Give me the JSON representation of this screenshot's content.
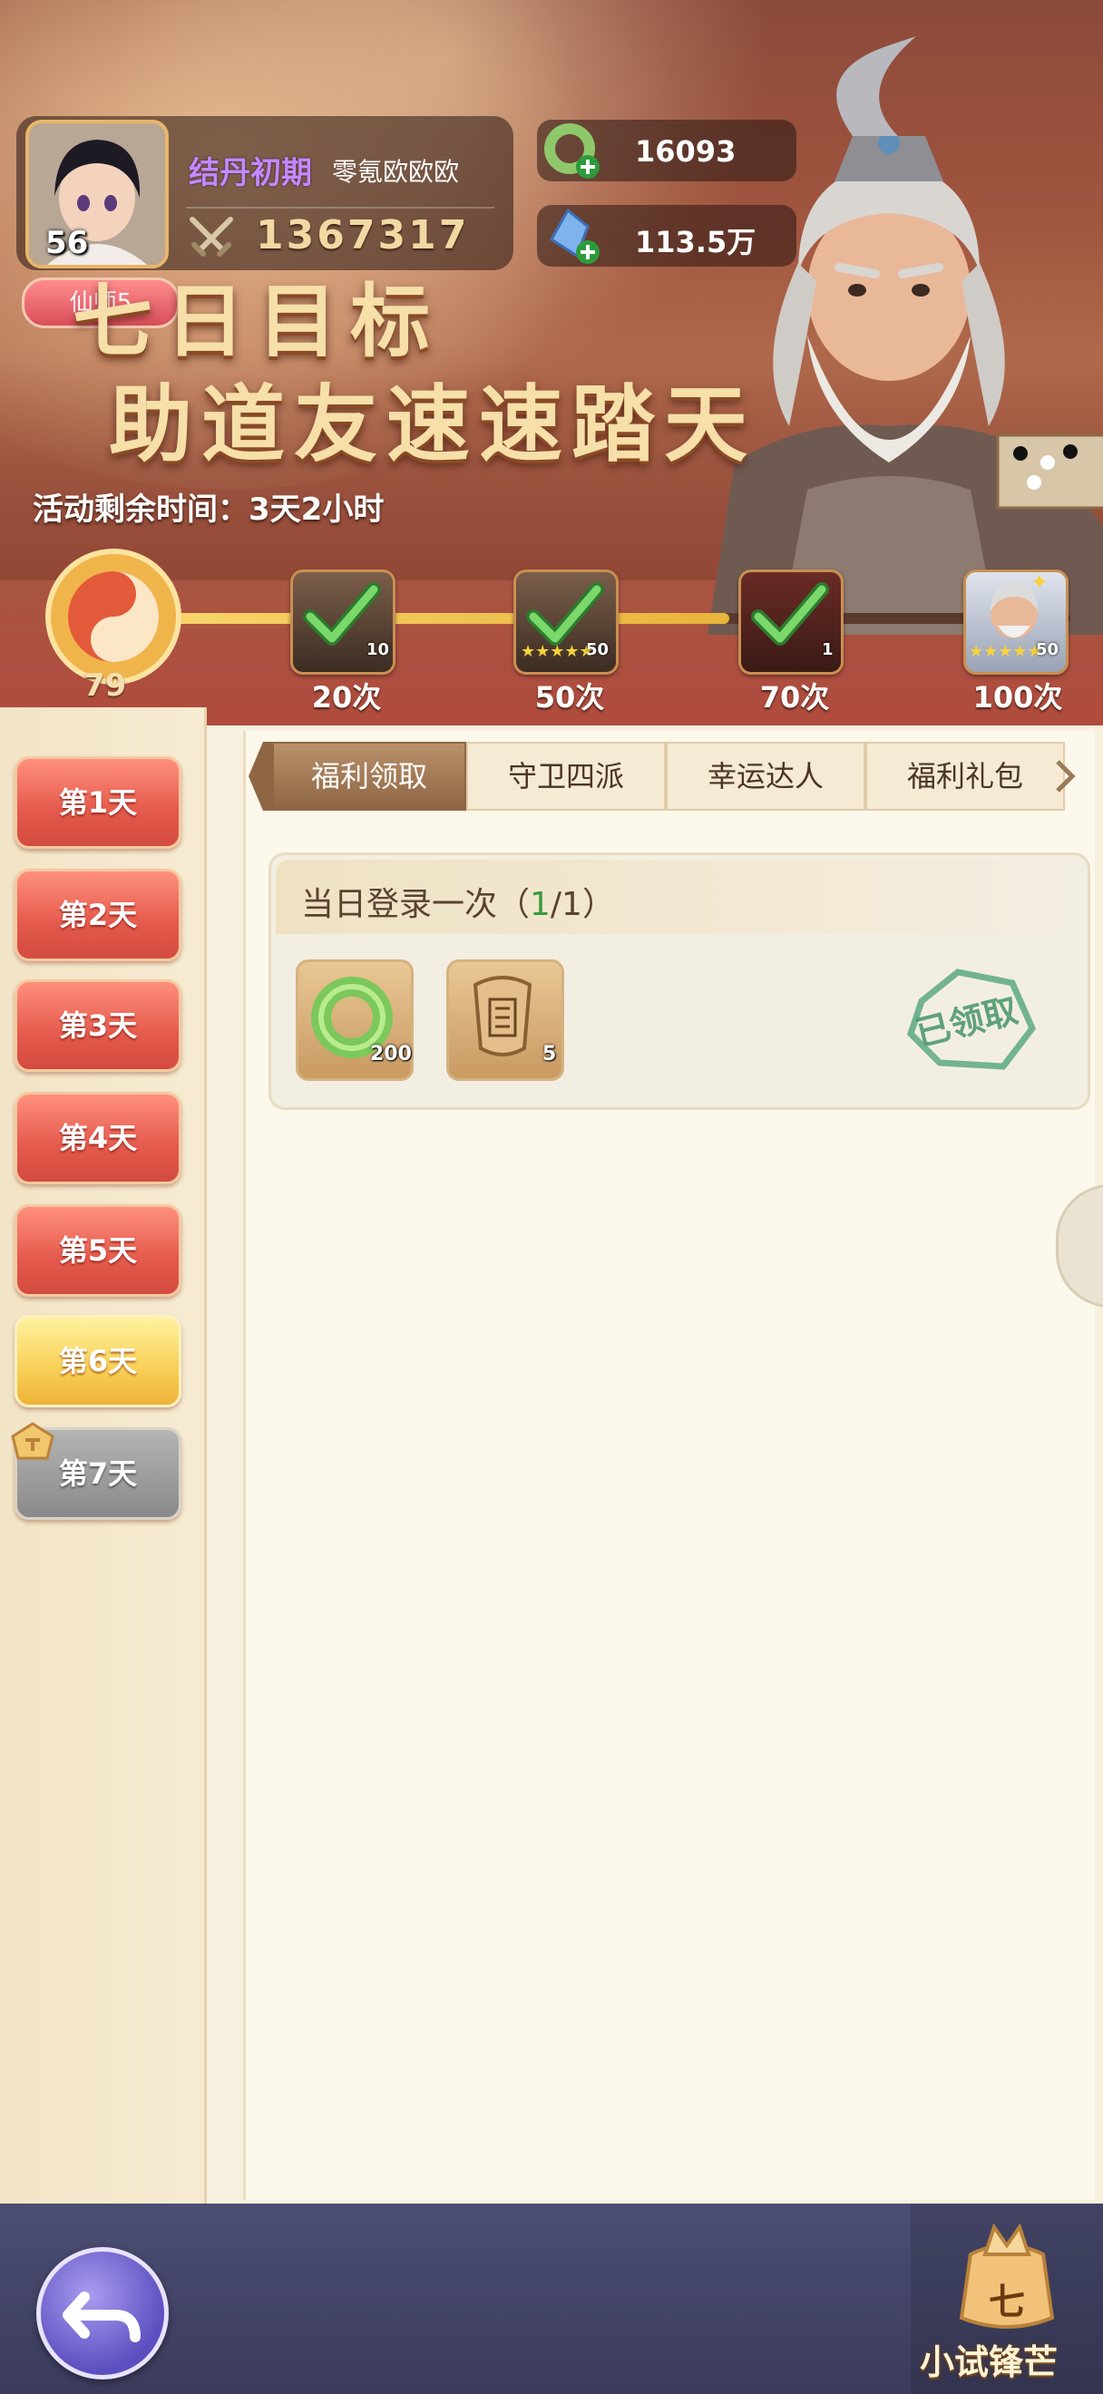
{
  "player": {
    "level": "56",
    "realm": "结丹初期",
    "name": "零氪欧欧欧",
    "power": "1367317",
    "rank_badge": "仙师5"
  },
  "currencies": [
    {
      "icon": "jade-ring-plus-icon",
      "value": "16093"
    },
    {
      "icon": "crystal-plus-icon",
      "value": "113.5万"
    }
  ],
  "banner": {
    "title_line1": "七日目标",
    "title_line2": "助道友速速踏天",
    "time_left": "活动剩余时间：3天2小时"
  },
  "progress": {
    "score": "79",
    "fill_fraction": 0.62,
    "milestones": [
      {
        "label": "20次",
        "count": "10",
        "claimed": true
      },
      {
        "label": "50次",
        "count": "50",
        "claimed": true
      },
      {
        "label": "70次",
        "count": "1",
        "claimed": true
      },
      {
        "label": "100次",
        "count": "50",
        "claimed": false
      }
    ]
  },
  "days": [
    {
      "label": "第1天",
      "state": "normal"
    },
    {
      "label": "第2天",
      "state": "normal"
    },
    {
      "label": "第3天",
      "state": "normal"
    },
    {
      "label": "第4天",
      "state": "normal"
    },
    {
      "label": "第5天",
      "state": "normal"
    },
    {
      "label": "第6天",
      "state": "active"
    },
    {
      "label": "第7天",
      "state": "locked"
    }
  ],
  "tabs": [
    "福利领取",
    "守卫四派",
    "幸运达人",
    "福利礼包"
  ],
  "task": {
    "title_prefix": "当日登录一次（",
    "done": "1",
    "sep_total": "/1）",
    "rewards": [
      {
        "icon": "jade-ring-icon",
        "count": "200"
      },
      {
        "icon": "scroll-token-icon",
        "count": "5"
      }
    ],
    "status": "已领取"
  },
  "bottom": {
    "badge_char": "七",
    "badge_label": "小试锋芒"
  },
  "colors": {
    "accent_gold": "#f8cf55",
    "day_red": "#e45a4c",
    "realm_purple": "#c28aff",
    "claimed_green": "#4f9a6e"
  }
}
